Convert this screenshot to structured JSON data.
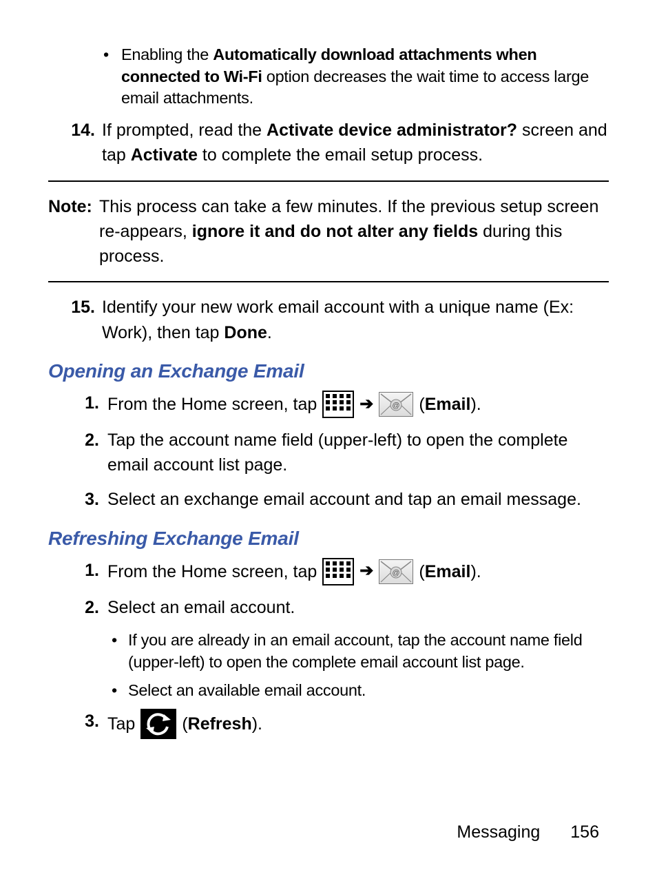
{
  "bullet13": {
    "pre": "Enabling the ",
    "bold": "Automatically download attachments when connected to Wi-Fi",
    "post": " option decreases the wait time to access large email attachments."
  },
  "step14": {
    "num": "14.",
    "t1": "If prompted, read the ",
    "b1": "Activate device administrator?",
    "t2": " screen and tap ",
    "b2": "Activate",
    "t3": " to complete the email setup process."
  },
  "note": {
    "label": "Note:",
    "t1": "This process can take a few minutes. If the previous setup screen re-appears, ",
    "b1": "ignore it and do not alter any fields",
    "t2": " during this process."
  },
  "step15": {
    "num": "15.",
    "t1": "Identify your new work email account with a unique name (Ex: Work), then tap ",
    "b1": "Done",
    "t2": "."
  },
  "heading1": "Opening an Exchange Email",
  "open": {
    "s1": {
      "num": "1.",
      "t1": "From the Home screen, tap",
      "arrow": "➔",
      "paren_open": "(",
      "b": "Email",
      "paren_close": ")."
    },
    "s2": {
      "num": "2.",
      "t": "Tap the account name field (upper-left) to open the complete email account list page."
    },
    "s3": {
      "num": "3.",
      "t": "Select an exchange email account and tap an email message."
    }
  },
  "heading2": "Refreshing Exchange Email",
  "refresh": {
    "s1": {
      "num": "1.",
      "t1": "From the Home screen, tap",
      "arrow": "➔",
      "paren_open": "(",
      "b": "Email",
      "paren_close": ")."
    },
    "s2": {
      "num": "2.",
      "t": "Select an email account."
    },
    "sb1": "If you are already in an email account, tap the account name field (upper-left) to open the complete email account list page.",
    "sb2": "Select an available email account.",
    "s3": {
      "num": "3.",
      "t1": "Tap",
      "paren_open": "(",
      "b": "Refresh",
      "paren_close": ")."
    }
  },
  "footer": {
    "section": "Messaging",
    "page": "156"
  }
}
